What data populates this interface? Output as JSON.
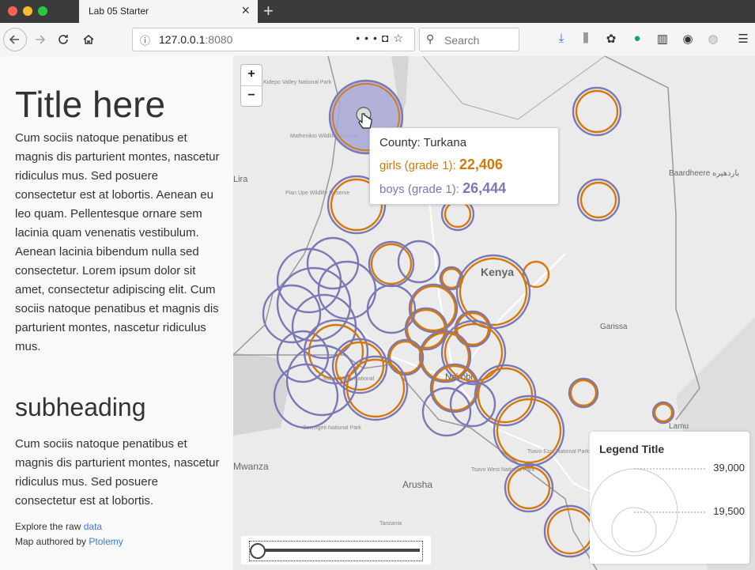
{
  "browser": {
    "tab_title": "Lab 05 Starter",
    "url_host": "127.0.0.1",
    "url_port": ":8080",
    "search_placeholder": "Search",
    "colors": {
      "close": "#fe5f57",
      "minimize": "#febc2e",
      "maximize": "#28c840"
    }
  },
  "sidebar": {
    "title": "Title here",
    "paragraph1": "Cum sociis natoque penatibus et magnis dis parturient montes, nascetur ridiculus mus. Sed posuere consectetur est at lobortis. Aenean eu leo quam. Pellentesque ornare sem lacinia quam venenatis vestibulum. Aenean lacinia bibendum nulla sed consectetur. Lorem ipsum dolor sit amet, consectetur adipiscing elit. Cum sociis natoque penatibus et magnis dis parturient montes, nascetur ridiculus mus.",
    "subheading": "subheading",
    "paragraph2": "Cum sociis natoque penatibus et magnis dis parturient montes, nascetur ridiculus mus. Sed posuere consectetur est at lobortis.",
    "explore_text": "Explore the raw ",
    "explore_link": "data",
    "author_text": "Map authored by ",
    "author_link": "Ptolemy"
  },
  "map": {
    "zoom_in": "+",
    "zoom_out": "−",
    "place_labels": [
      "Kenya",
      "Nairobi",
      "Garissa",
      "Lamu",
      "Arusha",
      "Mwanza",
      "Lira",
      "Baardheere باردهيرە",
      "Kidepo Valley National Park",
      "Mathenikio Wildlife Reserve",
      "Pian Upe Wildlife Reserve",
      "Masai Mara National",
      "Serengeti National Park",
      "Tsavo East National Park",
      "Tsavo West National Park",
      "Tanzania"
    ],
    "colors": {
      "girls": "#d4780c",
      "boys": "#7b78b4",
      "hover_fill": "#a7a7d6"
    },
    "tooltip": {
      "county_label": "County: Turkana",
      "girls_label": "girls (grade 1): ",
      "girls_value": "22,406",
      "boys_label": "boys (grade 1): ",
      "boys_value": "26,444"
    },
    "legend": {
      "title": "Legend Title",
      "max_label": "39,000",
      "mid_label": "19,500"
    }
  }
}
